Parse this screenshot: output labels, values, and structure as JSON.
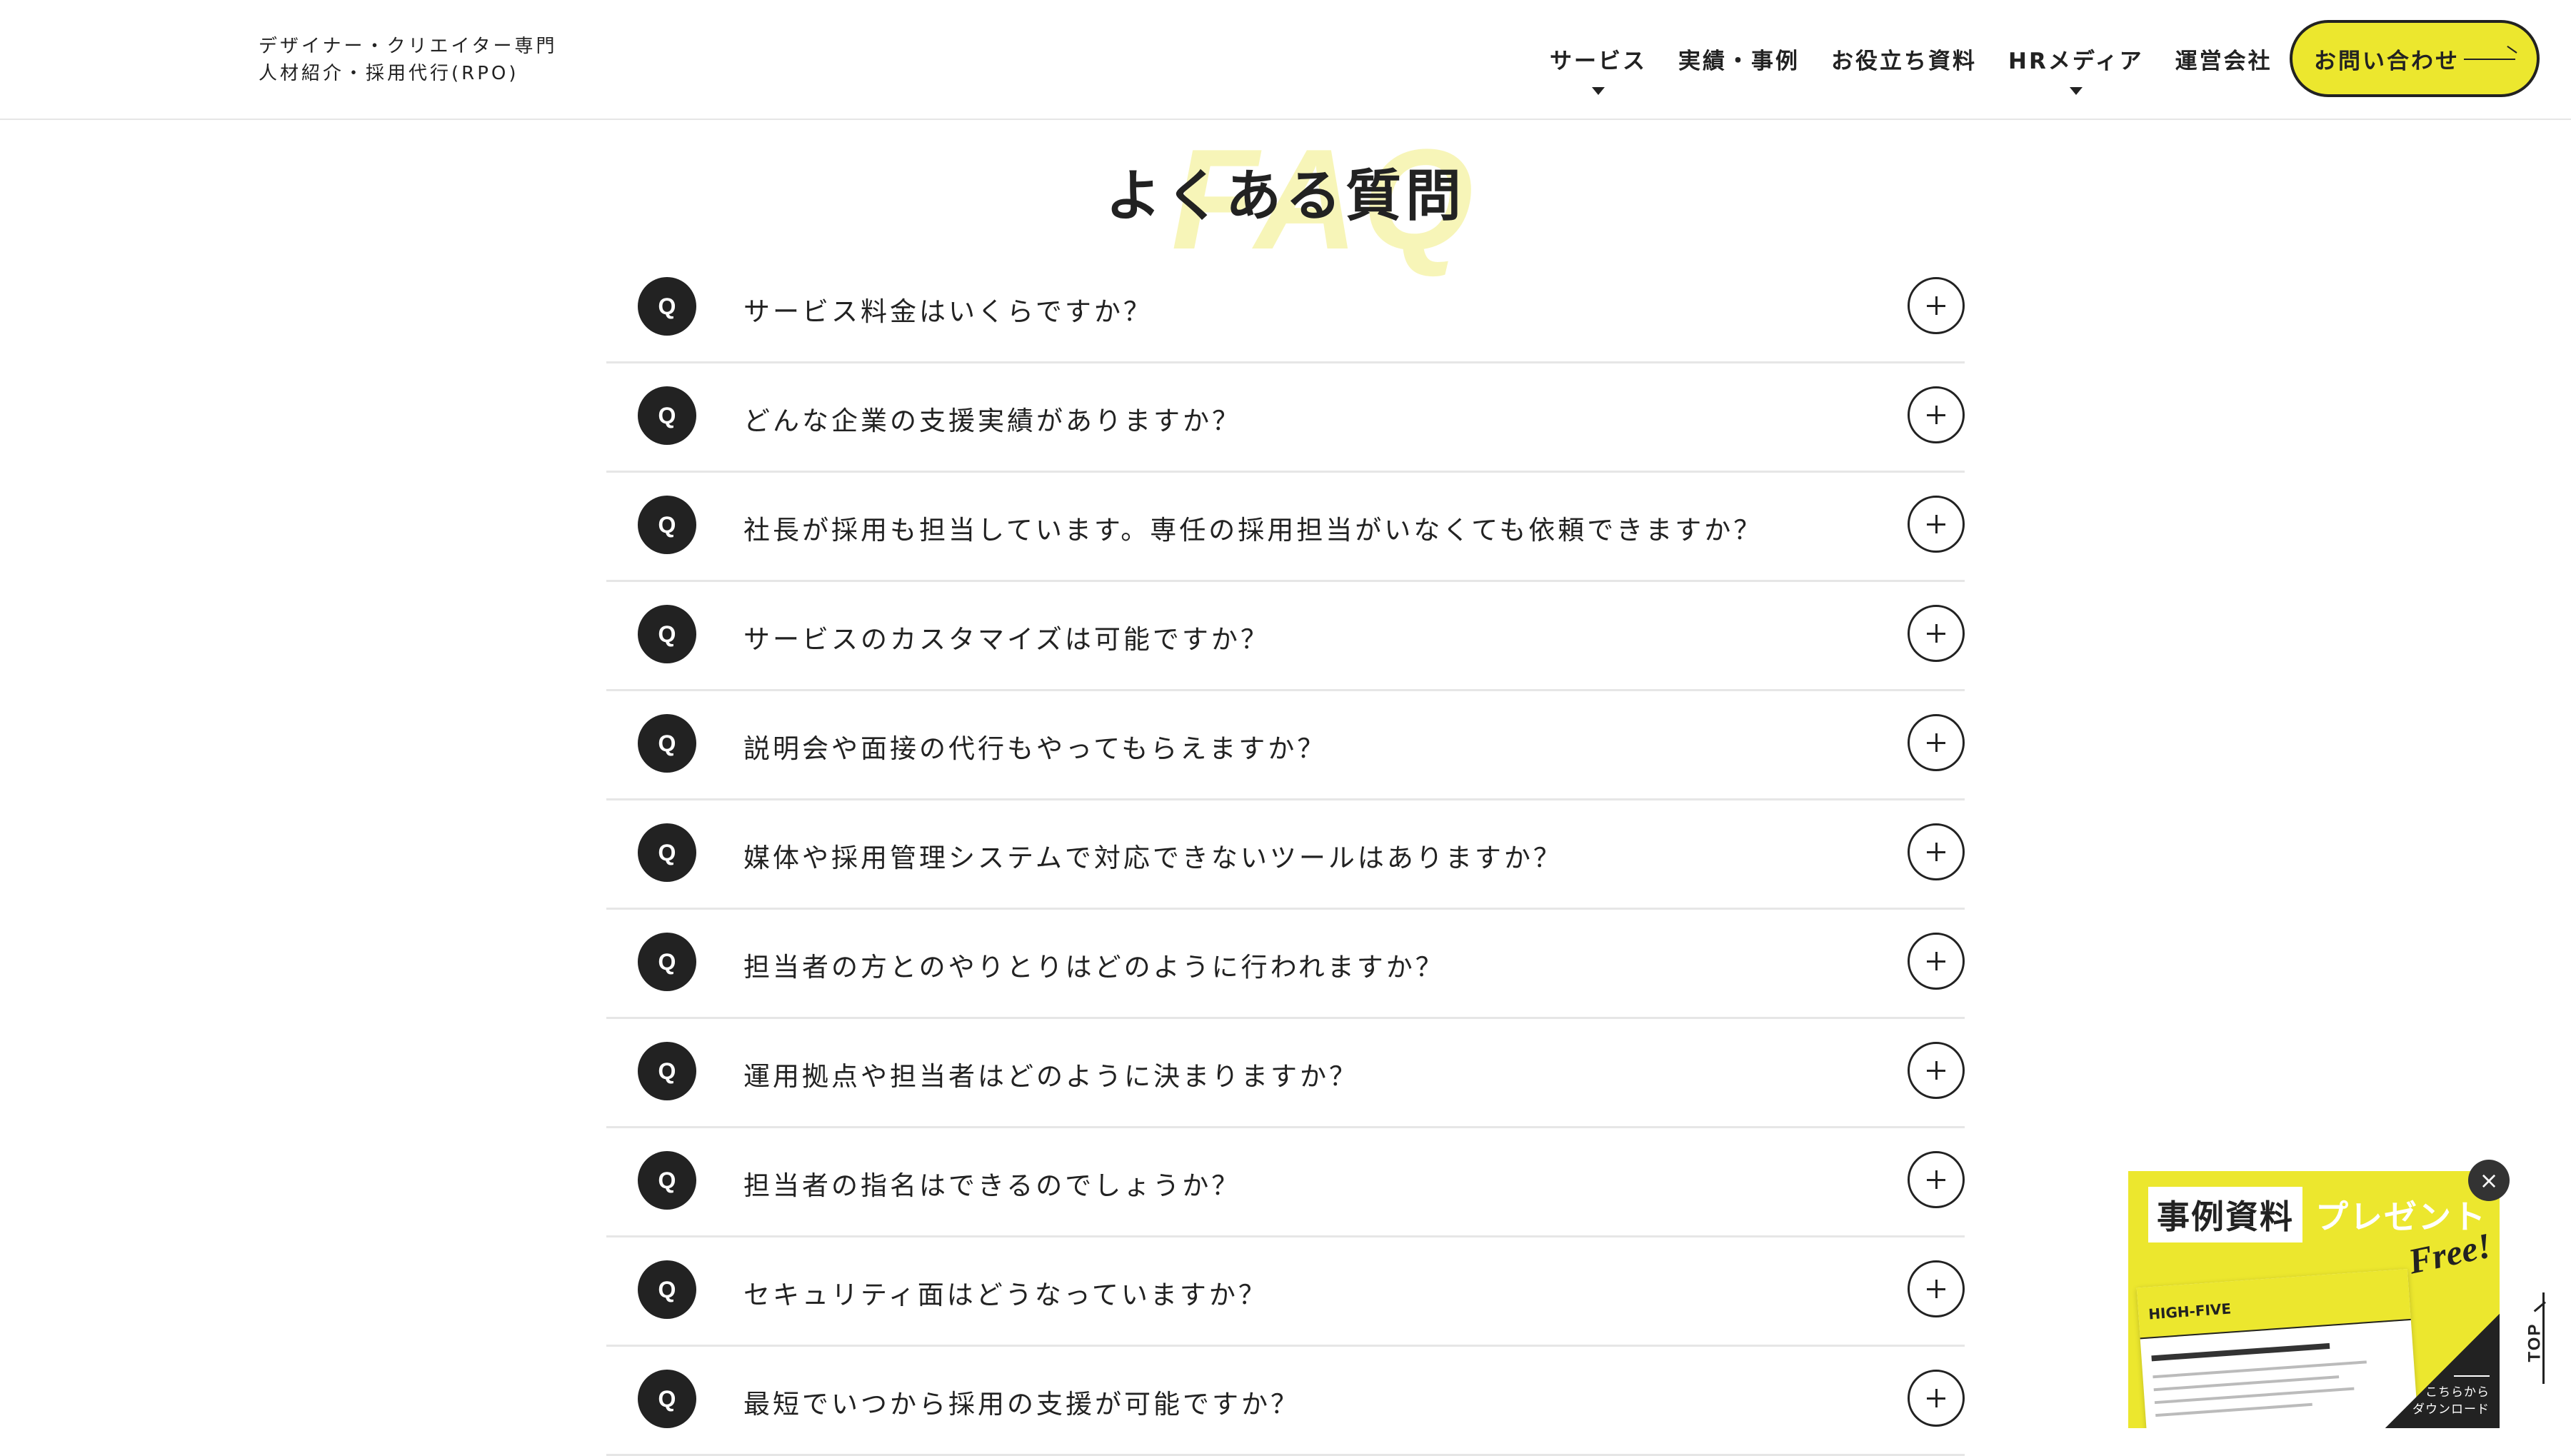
{
  "header": {
    "brand_line1": "デザイナー・クリエイター専門",
    "brand_line2": "人材紹介・採用代行(RPO)",
    "nav": [
      {
        "label": "サービス",
        "has_dropdown": true
      },
      {
        "label": "実績・事例",
        "has_dropdown": false
      },
      {
        "label": "お役立ち資料",
        "has_dropdown": false
      },
      {
        "label": "HRメディア",
        "has_dropdown": true
      },
      {
        "label": "運営会社",
        "has_dropdown": false
      }
    ],
    "contact_label": "お問い合わせ",
    "accent_color": "#ece72e"
  },
  "faq": {
    "bg_label": "FAQ",
    "title": "よくある質問",
    "q_mark": "Q",
    "items": [
      "サービス料金はいくらですか？",
      "どんな企業の支援実績がありますか？",
      "社長が採用も担当しています。専任の採用担当がいなくても依頼できますか？",
      "サービスのカスタマイズは可能ですか？",
      "説明会や面接の代行もやってもらえますか？",
      "媒体や採用管理システムで対応できないツールはありますか？",
      "担当者の方とのやりとりはどのように行われますか？",
      "運用拠点や担当者はどのように決まりますか？",
      "担当者の指名はできるのでしょうか？",
      "セキュリティ面はどうなっていますか？",
      "最短でいつから採用の支援が可能ですか？"
    ]
  },
  "promo": {
    "heading": "事例資料",
    "present": "プレゼント",
    "free": "Free!",
    "doc_logo": "HIGH-FIVE",
    "download_line1": "こちらから",
    "download_line2": "ダウンロード",
    "close_icon": "×"
  },
  "top_link": {
    "label": "TOP"
  }
}
